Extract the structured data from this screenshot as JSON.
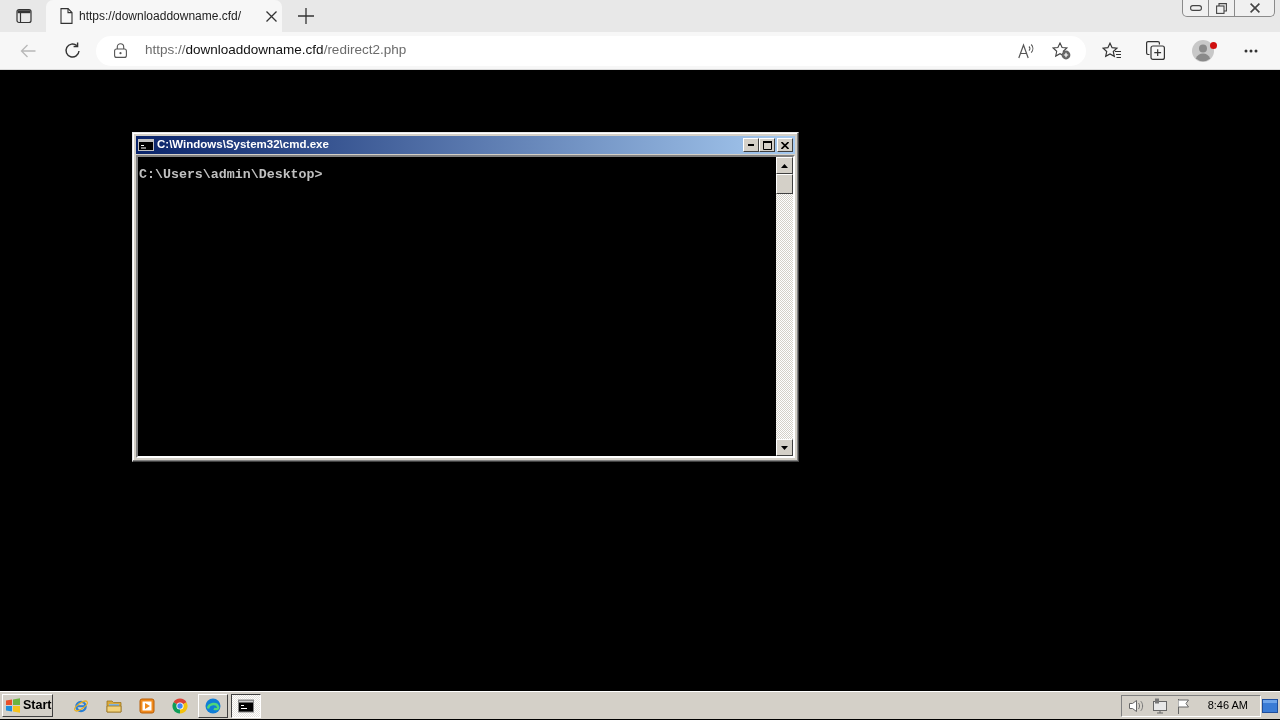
{
  "browser": {
    "tab": {
      "title": "https://downloaddowname.cfd/"
    },
    "back_disabled": true,
    "address": {
      "scheme": "https://",
      "host": "downloaddowname.cfd",
      "path": "/redirect2.php"
    }
  },
  "console_window": {
    "title": "C:\\Windows\\System32\\cmd.exe",
    "lines": [
      "C:\\Users\\admin\\Desktop>"
    ]
  },
  "taskbar": {
    "start_label": "Start",
    "apps": [
      {
        "kind": "ie",
        "running": false,
        "selected": false
      },
      {
        "kind": "folder",
        "running": false,
        "selected": false
      },
      {
        "kind": "player",
        "running": false,
        "selected": false
      },
      {
        "kind": "chrome",
        "running": false,
        "selected": false
      },
      {
        "kind": "edge",
        "running": true,
        "selected": false
      },
      {
        "kind": "console",
        "running": true,
        "selected": true
      }
    ],
    "clock": "8:46 AM"
  }
}
